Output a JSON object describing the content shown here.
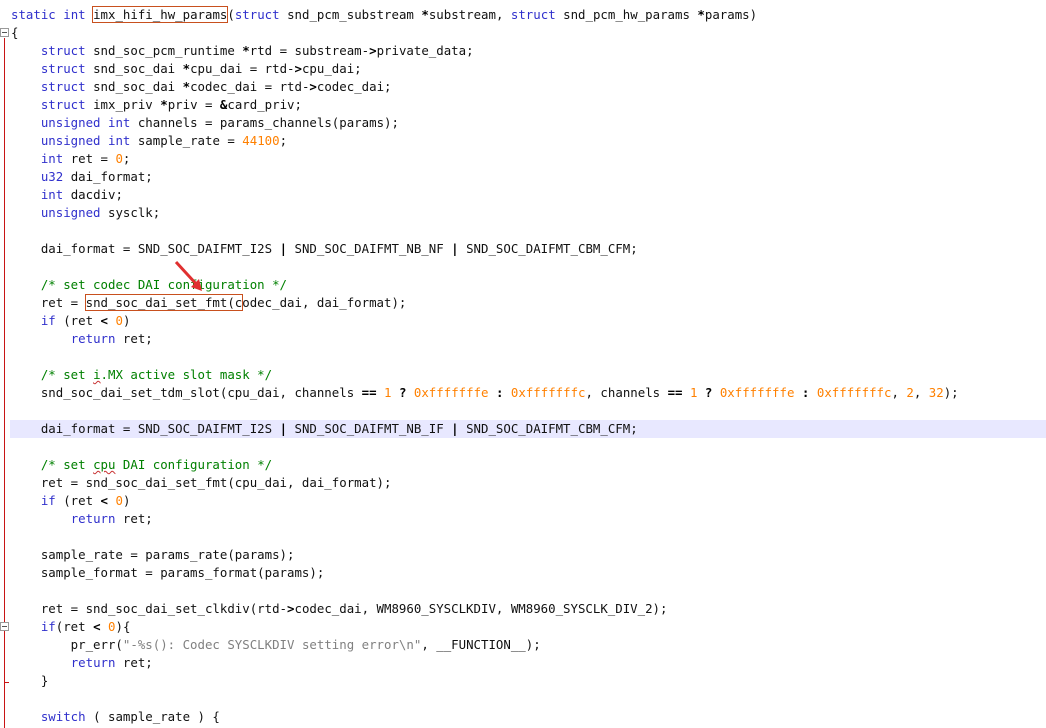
{
  "editor": {
    "language": "C",
    "highlight_colors": {
      "keyword": "#3030cc",
      "number": "#ff8000",
      "comment": "#008000",
      "string": "#808080",
      "annotation_box": "#c8501e",
      "current_line": "#e8e8ff"
    },
    "lines": [
      "static int imx_hifi_hw_params(struct snd_pcm_substream *substream, struct snd_pcm_hw_params *params)",
      "{",
      "    struct snd_soc_pcm_runtime *rtd = substream->private_data;",
      "    struct snd_soc_dai *cpu_dai = rtd->cpu_dai;",
      "    struct snd_soc_dai *codec_dai = rtd->codec_dai;",
      "    struct imx_priv *priv = &card_priv;",
      "    unsigned int channels = params_channels(params);",
      "    unsigned int sample_rate = 44100;",
      "    int ret = 0;",
      "    u32 dai_format;",
      "    int dacdiv;",
      "    unsigned sysclk;",
      "",
      "    dai_format = SND_SOC_DAIFMT_I2S | SND_SOC_DAIFMT_NB_NF | SND_SOC_DAIFMT_CBM_CFM;",
      "",
      "    /* set codec DAI configuration */",
      "    ret = snd_soc_dai_set_fmt(codec_dai, dai_format);",
      "    if (ret < 0)",
      "        return ret;",
      "",
      "    /* set i.MX active slot mask */",
      "    snd_soc_dai_set_tdm_slot(cpu_dai, channels == 1 ? 0xfffffffe : 0xfffffffc, channels == 1 ? 0xfffffffe : 0xfffffffc, 2, 32);",
      "",
      "    dai_format = SND_SOC_DAIFMT_I2S | SND_SOC_DAIFMT_NB_IF | SND_SOC_DAIFMT_CBM_CFM;",
      "",
      "    /* set cpu DAI configuration */",
      "    ret = snd_soc_dai_set_fmt(cpu_dai, dai_format);",
      "    if (ret < 0)",
      "        return ret;",
      "",
      "    sample_rate = params_rate(params);",
      "    sample_format = params_format(params);",
      "",
      "    ret = snd_soc_dai_set_clkdiv(rtd->codec_dai, WM8960_SYSCLKDIV, WM8960_SYSCLK_DIV_2);",
      "    if(ret < 0){",
      "        pr_err(\"-%s(): Codec SYSCLKDIV setting error\\n\", __FUNCTION__);",
      "        return ret;",
      "    }",
      "",
      "    switch ( sample_rate ) {"
    ],
    "current_line_index": 23,
    "annotations": [
      {
        "type": "box",
        "line": 0,
        "text": "imx_hifi_hw_params"
      },
      {
        "type": "box",
        "line": 16,
        "text": "snd_soc_dai_set_fmt(c"
      },
      {
        "type": "arrow",
        "color": "#e03030"
      }
    ]
  }
}
